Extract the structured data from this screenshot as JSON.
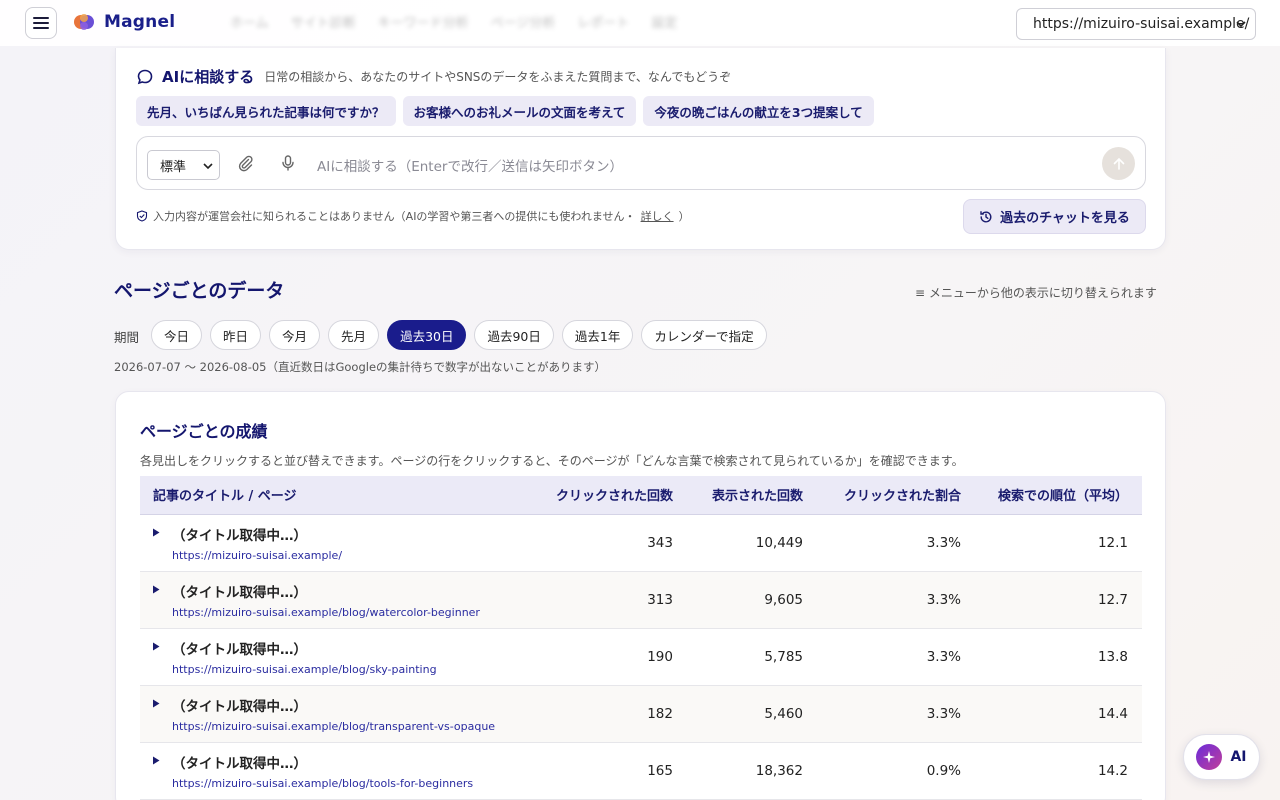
{
  "header": {
    "app_name": "Magnel",
    "site_selected": "https://mizuiro-suisai.example/",
    "blurred_nav": [
      "ホーム",
      "サイト診断",
      "キーワード分析",
      "ページ分析",
      "レポート",
      "設定"
    ]
  },
  "ai_panel": {
    "title": "AIに相談する",
    "description": "日常の相談から、あなたのサイトやSNSのデータをふまえた質問まで、なんでもどうぞ",
    "suggestions": [
      "先月、いちばん見られた記事は何ですか？",
      "お客様へのお礼メールの文面を考えて",
      "今夜の晩ごはんの献立を3つ提案して"
    ],
    "mode": "標準",
    "input_placeholder": "AIに相談する（Enterで改行／送信は矢印ボタン）",
    "privacy_text": "入力内容が運営会社に知られることはありません（AIの学習や第三者への提供にも使われません・",
    "privacy_link": "詳しく",
    "privacy_close": "）",
    "history_button": "過去のチャットを見る"
  },
  "section": {
    "title": "ページごとのデータ",
    "menu_hint": "≡ メニューから他の表示に切り替えられます",
    "period_label": "期間",
    "periods": [
      "今日",
      "昨日",
      "今月",
      "先月",
      "過去30日",
      "過去90日",
      "過去1年",
      "カレンダーで指定"
    ],
    "active_period": "過去30日",
    "date_note": "2026-07-07 〜 2026-08-05（直近数日はGoogleの集計待ちで数字が出ないことがあります）"
  },
  "table": {
    "title": "ページごとの成績",
    "description": "各見出しをクリックすると並び替えできます。ページの行をクリックすると、そのページが「どんな言葉で検索されて見られているか」を確認できます。",
    "columns": [
      "記事のタイトル / ページ",
      "クリックされた回数",
      "表示された回数",
      "クリックされた割合",
      "検索での順位（平均）"
    ],
    "rows": [
      {
        "title": "（タイトル取得中…）",
        "url": "https://mizuiro-suisai.example/",
        "clicks": "343",
        "impressions": "10,449",
        "ctr": "3.3%",
        "position": "12.1"
      },
      {
        "title": "（タイトル取得中…）",
        "url": "https://mizuiro-suisai.example/blog/watercolor-beginner",
        "clicks": "313",
        "impressions": "9,605",
        "ctr": "3.3%",
        "position": "12.7"
      },
      {
        "title": "（タイトル取得中…）",
        "url": "https://mizuiro-suisai.example/blog/sky-painting",
        "clicks": "190",
        "impressions": "5,785",
        "ctr": "3.3%",
        "position": "13.8"
      },
      {
        "title": "（タイトル取得中…）",
        "url": "https://mizuiro-suisai.example/blog/transparent-vs-opaque",
        "clicks": "182",
        "impressions": "5,460",
        "ctr": "3.3%",
        "position": "14.4"
      },
      {
        "title": "（タイトル取得中…）",
        "url": "https://mizuiro-suisai.example/blog/tools-for-beginners",
        "clicks": "165",
        "impressions": "18,362",
        "ctr": "0.9%",
        "position": "14.2"
      }
    ]
  },
  "fab": {
    "label": "AI"
  },
  "colors": {
    "brand": "#14166e",
    "accent": "#1a1c8c",
    "chip_bg": "#eceaf6"
  }
}
